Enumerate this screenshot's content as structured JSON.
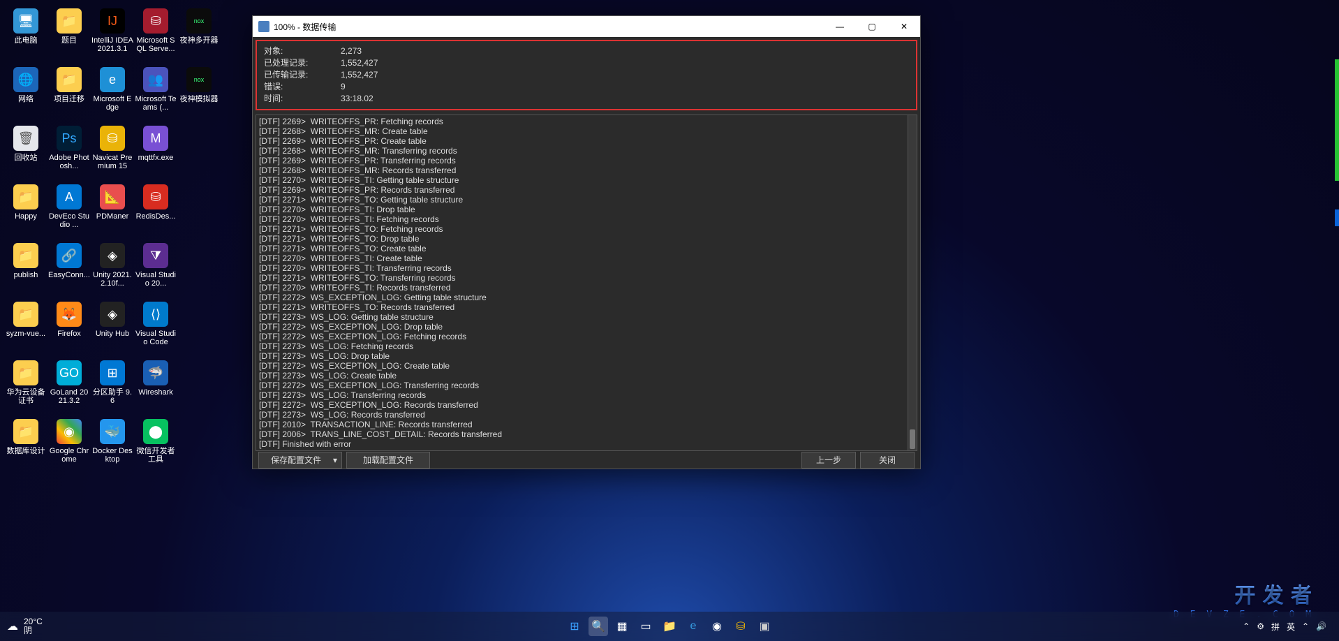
{
  "desktop": {
    "rows": [
      [
        {
          "label": "此电脑",
          "cls": "c-pc",
          "glyph": "🖥"
        },
        {
          "label": "题目",
          "cls": "c-folder",
          "glyph": "📁"
        },
        {
          "label": "IntelliJ IDEA 2021.3.1",
          "cls": "c-intellij",
          "glyph": "IJ"
        },
        {
          "label": "Microsoft SQL Serve...",
          "cls": "c-sqlserv",
          "glyph": "⛁"
        },
        {
          "label": "夜神多开器",
          "cls": "c-nox",
          "glyph": "nox"
        }
      ],
      [
        {
          "label": "网络",
          "cls": "c-net",
          "glyph": "🌐"
        },
        {
          "label": "项目迁移",
          "cls": "c-folder",
          "glyph": "📁"
        },
        {
          "label": "Microsoft Edge",
          "cls": "c-edge",
          "glyph": "e"
        },
        {
          "label": "Microsoft Teams (...",
          "cls": "c-teams",
          "glyph": "👥"
        },
        {
          "label": "夜神模拟器",
          "cls": "c-nox",
          "glyph": "nox"
        }
      ],
      [
        {
          "label": "回收站",
          "cls": "c-bin",
          "glyph": "🗑"
        },
        {
          "label": "Adobe Photosh...",
          "cls": "c-ps",
          "glyph": "Ps"
        },
        {
          "label": "Navicat Premium 15",
          "cls": "c-nav",
          "glyph": "⛁"
        },
        {
          "label": "mqttfx.exe",
          "cls": "c-mqtt",
          "glyph": "M"
        },
        null
      ],
      [
        {
          "label": "Happy",
          "cls": "c-folder",
          "glyph": "📁"
        },
        {
          "label": "DevEco Studio ...",
          "cls": "c-azure",
          "glyph": "A"
        },
        {
          "label": "PDManer",
          "cls": "c-pdm",
          "glyph": "📐"
        },
        {
          "label": "RedisDes...",
          "cls": "c-redis",
          "glyph": "⛁"
        },
        null
      ],
      [
        {
          "label": "publish",
          "cls": "c-folder",
          "glyph": "📁"
        },
        {
          "label": "EasyConn...",
          "cls": "c-easy",
          "glyph": "🔗"
        },
        {
          "label": "Unity 2021.2.10f...",
          "cls": "c-unity",
          "glyph": "◈"
        },
        {
          "label": "Visual Studio 20...",
          "cls": "c-vs",
          "glyph": "⧩"
        },
        null
      ],
      [
        {
          "label": "syzm-vue...",
          "cls": "c-folder",
          "glyph": "📁"
        },
        {
          "label": "Firefox",
          "cls": "c-ff",
          "glyph": "🦊"
        },
        {
          "label": "Unity Hub",
          "cls": "c-unity",
          "glyph": "◈"
        },
        {
          "label": "Visual Studio Code",
          "cls": "c-vscode",
          "glyph": "⟨⟩"
        },
        null
      ],
      [
        {
          "label": "华为云设备证书",
          "cls": "c-folder",
          "glyph": "📁"
        },
        {
          "label": "GoLand 2021.3.2",
          "cls": "c-goland",
          "glyph": "GO"
        },
        {
          "label": "分区助手 9.6",
          "cls": "c-part",
          "glyph": "⊞"
        },
        {
          "label": "Wireshark",
          "cls": "c-ws",
          "glyph": "🦈"
        },
        null
      ],
      [
        {
          "label": "数据库设计",
          "cls": "c-folder",
          "glyph": "📁"
        },
        {
          "label": "Google Chrome",
          "cls": "c-chrome",
          "glyph": "◉"
        },
        {
          "label": "Docker Desktop",
          "cls": "c-docker",
          "glyph": "🐳"
        },
        {
          "label": "微信开发者工具",
          "cls": "c-wxdev",
          "glyph": "⬤"
        },
        null
      ]
    ]
  },
  "dialog": {
    "title": "100% - 数据传输",
    "stats": {
      "objects_k": "对象:",
      "objects_v": "2,273",
      "processed_k": "已处理记录:",
      "processed_v": "1,552,427",
      "transferred_k": "已传输记录:",
      "transferred_v": "1,552,427",
      "errors_k": "错误:",
      "errors_v": "9",
      "time_k": "时间:",
      "time_v": "33:18.02"
    },
    "log": [
      "[DTF] 2269>  WRITEOFFS_PR: Fetching records",
      "[DTF] 2268>  WRITEOFFS_MR: Create table",
      "[DTF] 2269>  WRITEOFFS_PR: Create table",
      "[DTF] 2268>  WRITEOFFS_MR: Transferring records",
      "[DTF] 2269>  WRITEOFFS_PR: Transferring records",
      "[DTF] 2268>  WRITEOFFS_MR: Records transferred",
      "[DTF] 2270>  WRITEOFFS_TI: Getting table structure",
      "[DTF] 2269>  WRITEOFFS_PR: Records transferred",
      "[DTF] 2271>  WRITEOFFS_TO: Getting table structure",
      "[DTF] 2270>  WRITEOFFS_TI: Drop table",
      "[DTF] 2270>  WRITEOFFS_TI: Fetching records",
      "[DTF] 2271>  WRITEOFFS_TO: Fetching records",
      "[DTF] 2271>  WRITEOFFS_TO: Drop table",
      "[DTF] 2271>  WRITEOFFS_TO: Create table",
      "[DTF] 2270>  WRITEOFFS_TI: Create table",
      "[DTF] 2270>  WRITEOFFS_TI: Transferring records",
      "[DTF] 2271>  WRITEOFFS_TO: Transferring records",
      "[DTF] 2270>  WRITEOFFS_TI: Records transferred",
      "[DTF] 2272>  WS_EXCEPTION_LOG: Getting table structure",
      "[DTF] 2271>  WRITEOFFS_TO: Records transferred",
      "[DTF] 2273>  WS_LOG: Getting table structure",
      "[DTF] 2272>  WS_EXCEPTION_LOG: Drop table",
      "[DTF] 2272>  WS_EXCEPTION_LOG: Fetching records",
      "[DTF] 2273>  WS_LOG: Fetching records",
      "[DTF] 2273>  WS_LOG: Drop table",
      "[DTF] 2272>  WS_EXCEPTION_LOG: Create table",
      "[DTF] 2273>  WS_LOG: Create table",
      "[DTF] 2272>  WS_EXCEPTION_LOG: Transferring records",
      "[DTF] 2273>  WS_LOG: Transferring records",
      "[DTF] 2272>  WS_EXCEPTION_LOG: Records transferred",
      "[DTF] 2273>  WS_LOG: Records transferred",
      "[DTF] 2010>  TRANSACTION_LINE: Records transferred",
      "[DTF] 2006>  TRANS_LINE_COST_DETAIL: Records transferred",
      "[DTF] Finished with error"
    ],
    "footer": {
      "save": "保存配置文件",
      "load": "加载配置文件",
      "prev": "上一步",
      "close": "关闭"
    }
  },
  "taskbar": {
    "weather_temp": "20°C",
    "weather_cond": "阴",
    "lang": "英",
    "ime": "拼",
    "time": "",
    "date": "",
    "chevron": "⌃"
  },
  "watermark": {
    "line1": "开 发 者",
    "line2": "D E V Z E . C O M"
  }
}
